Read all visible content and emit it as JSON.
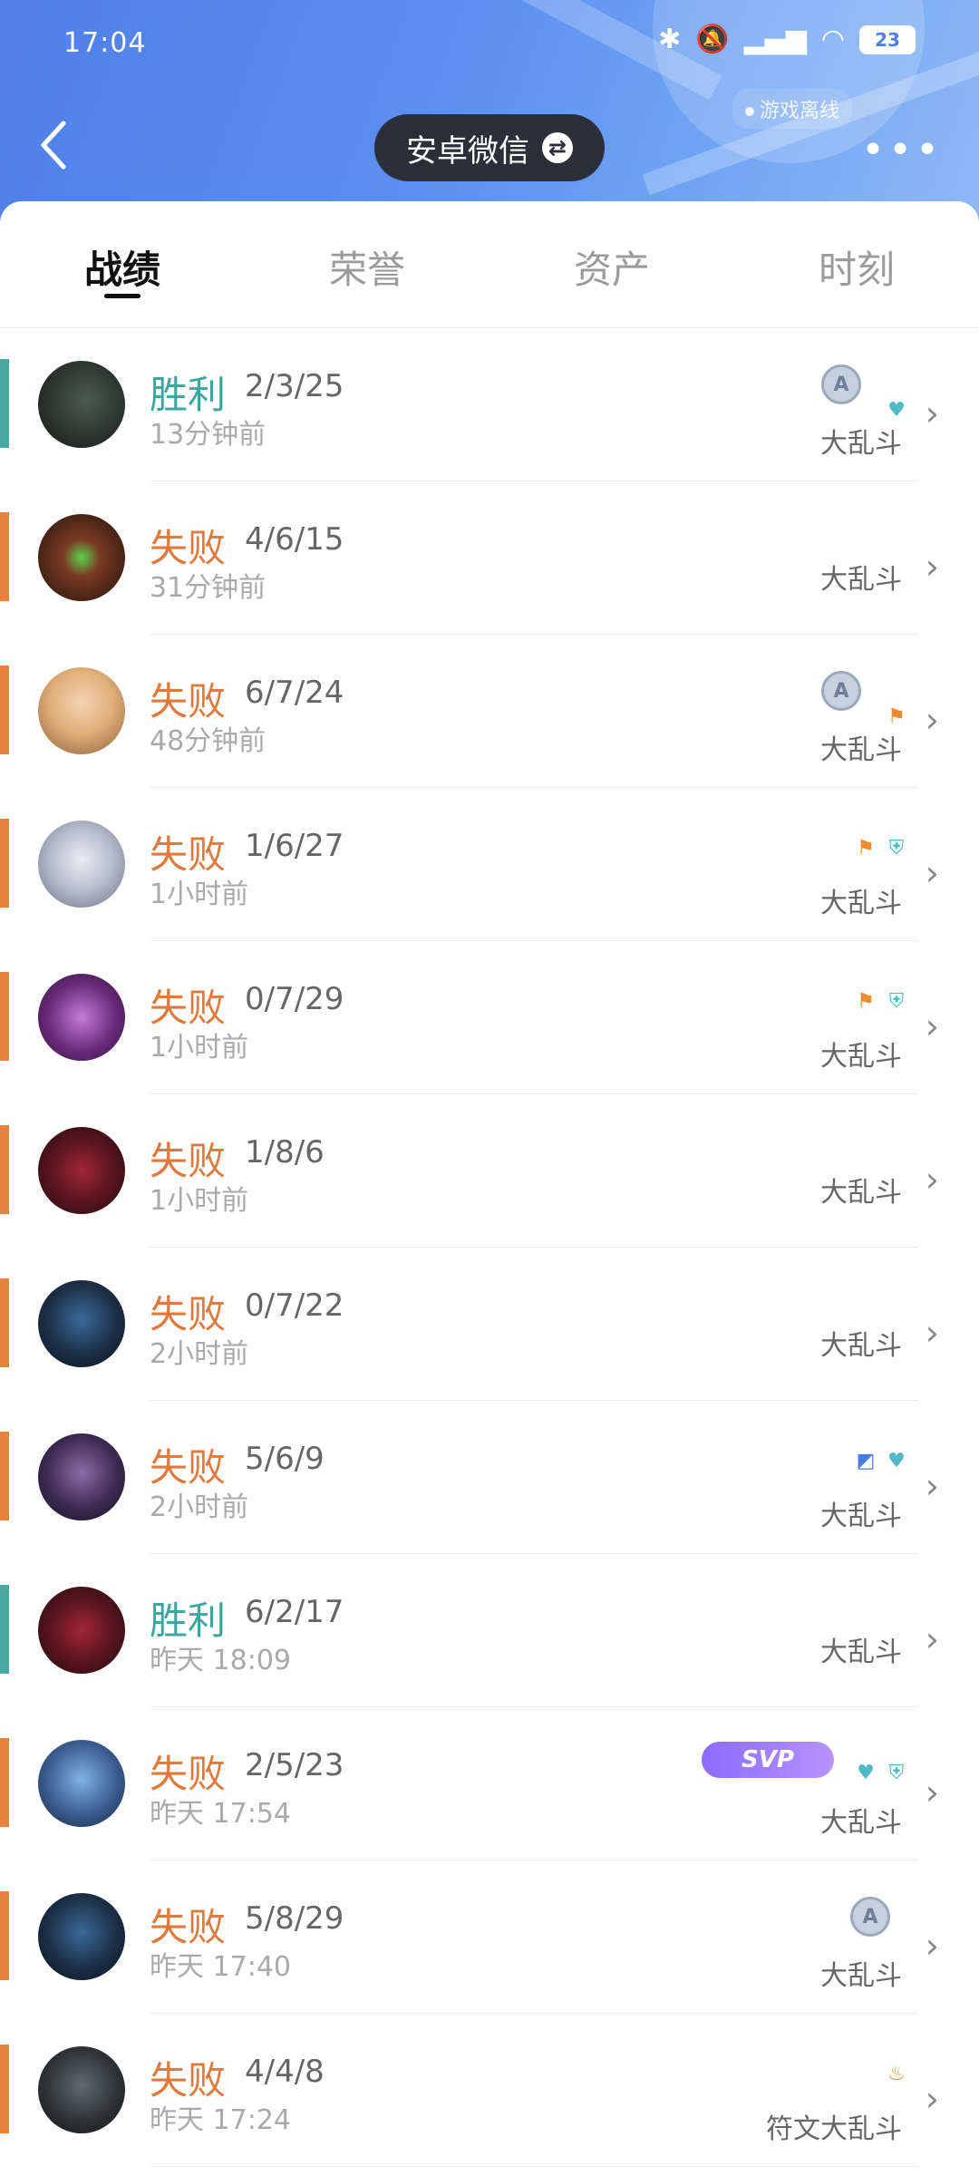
{
  "status": {
    "time": "17:04",
    "battery": "23",
    "offline_label": "游戏离线"
  },
  "header": {
    "account_label": "安卓微信",
    "swap_icon": "swap-icon",
    "more_icon": "more-icon",
    "back_icon": "back-icon"
  },
  "tabs": [
    {
      "label": "战绩",
      "active": true
    },
    {
      "label": "荣誉",
      "active": false
    },
    {
      "label": "资产",
      "active": false
    },
    {
      "label": "时刻",
      "active": false
    }
  ],
  "matches": [
    {
      "result": "胜利",
      "kda": "2/3/25",
      "time": "13分钟前",
      "mode": "大乱斗"
    },
    {
      "result": "失败",
      "kda": "4/6/15",
      "time": "31分钟前",
      "mode": "大乱斗"
    },
    {
      "result": "失败",
      "kda": "6/7/24",
      "time": "48分钟前",
      "mode": "大乱斗"
    },
    {
      "result": "失败",
      "kda": "1/6/27",
      "time": "1小时前",
      "mode": "大乱斗"
    },
    {
      "result": "失败",
      "kda": "0/7/29",
      "time": "1小时前",
      "mode": "大乱斗"
    },
    {
      "result": "失败",
      "kda": "1/8/6",
      "time": "1小时前",
      "mode": "大乱斗"
    },
    {
      "result": "失败",
      "kda": "0/7/22",
      "time": "2小时前",
      "mode": "大乱斗"
    },
    {
      "result": "失败",
      "kda": "5/6/9",
      "time": "2小时前",
      "mode": "大乱斗"
    },
    {
      "result": "胜利",
      "kda": "6/2/17",
      "time": "昨天 18:09",
      "mode": "大乱斗"
    },
    {
      "result": "失败",
      "kda": "2/5/23",
      "time": "昨天 17:54",
      "mode": "大乱斗",
      "svp": "SVP"
    },
    {
      "result": "失败",
      "kda": "5/8/29",
      "time": "昨天 17:40",
      "mode": "大乱斗"
    },
    {
      "result": "失败",
      "kda": "4/4/8",
      "time": "昨天 17:24",
      "mode": "符文大乱斗"
    }
  ],
  "badge_letter": "A",
  "colors": {
    "win": "#3aa69f",
    "lose": "#e07a3c",
    "header": "#4f7fe6"
  }
}
